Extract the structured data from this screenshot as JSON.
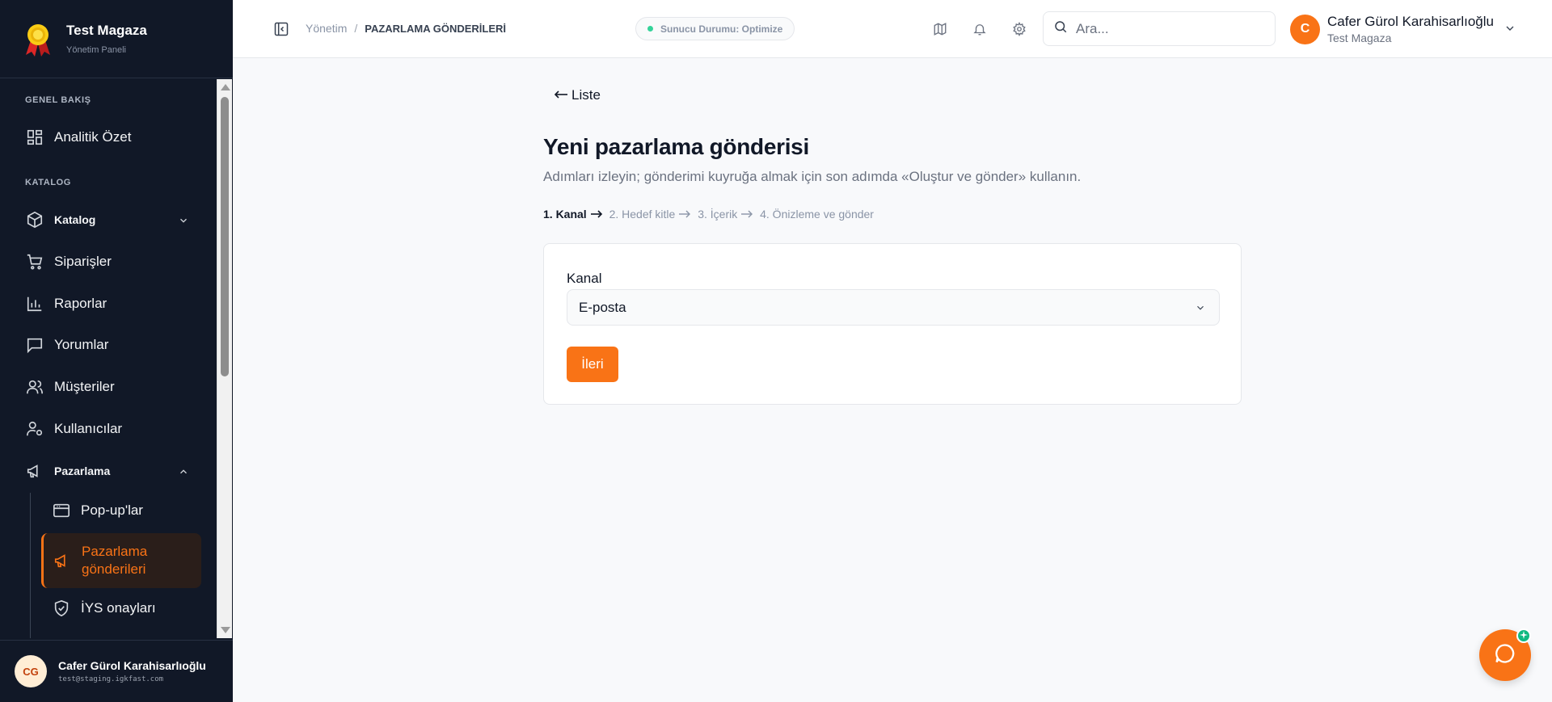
{
  "brand": {
    "title": "Test Magaza",
    "subtitle": "Yönetim Paneli",
    "logo_icon": "medal-icon"
  },
  "sidebar": {
    "sections": {
      "overview": "GENEL BAKIŞ",
      "catalog": "KATALOG"
    },
    "items": [
      {
        "label": "Analitik Özet",
        "icon": "dashboard-icon"
      },
      {
        "label": "Katalog",
        "icon": "box-icon"
      },
      {
        "label": "Siparişler",
        "icon": "cart-icon"
      },
      {
        "label": "Raporlar",
        "icon": "bar-chart-icon"
      },
      {
        "label": "Yorumlar",
        "icon": "message-icon"
      },
      {
        "label": "Müşteriler",
        "icon": "users-icon"
      },
      {
        "label": "Kullanıcılar",
        "icon": "user-cog-icon"
      },
      {
        "label": "Pazarlama",
        "icon": "megaphone-icon"
      }
    ],
    "sub_items": [
      {
        "label": "Pop-up'lar",
        "icon": "window-icon"
      },
      {
        "label": "Pazarlama gönderileri",
        "label_line1": "Pazarlama",
        "label_line2": "gönderileri",
        "icon": "megaphone-icon",
        "active": true
      },
      {
        "label": "İYS onayları",
        "icon": "shield-check-icon"
      }
    ]
  },
  "user_footer": {
    "initials": "CG",
    "name": "Cafer Gürol Karahisarlıoğlu",
    "email": "test@staging.igkfast.com"
  },
  "topbar": {
    "breadcrumb": {
      "parent": "Yönetim",
      "separator": "/",
      "current": "PAZARLAMA GÖNDERİLERİ"
    },
    "status": "Sunucu Durumu: Optimize",
    "search_placeholder": "Ara...",
    "profile": {
      "initial": "C",
      "name": "Cafer Gürol Karahisarlıoğlu",
      "store": "Test Magaza"
    }
  },
  "main": {
    "back_label": "Liste",
    "title": "Yeni pazarlama gönderisi",
    "subtitle": "Adımları izleyin; gönderimi kuyruğa almak için son adımda «Oluştur ve gönder» kullanın.",
    "steps": [
      "1. Kanal",
      "2. Hedef kitle",
      "3. İçerik",
      "4. Önizleme ve gönder"
    ],
    "active_step": 1,
    "form": {
      "channel_label": "Kanal",
      "channel_value": "E-posta",
      "next_label": "İleri"
    }
  },
  "colors": {
    "accent": "#f97316",
    "sidebar_bg": "#111827",
    "status_dot": "#34d399"
  }
}
